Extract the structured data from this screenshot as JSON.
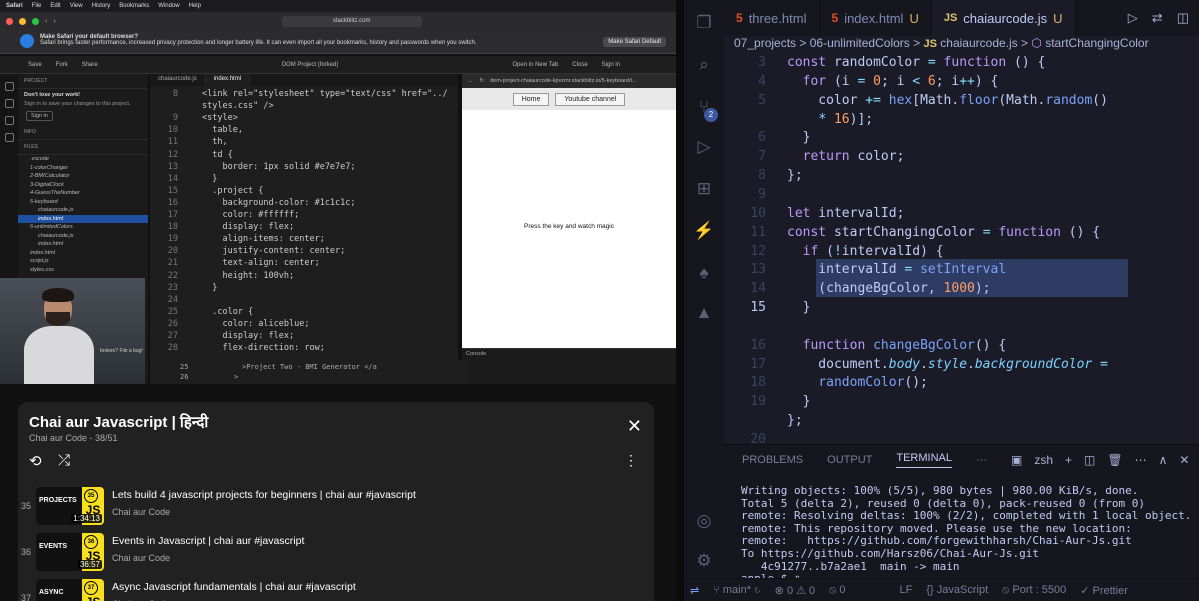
{
  "browser": {
    "menubar": [
      "Safari",
      "File",
      "Edit",
      "View",
      "History",
      "Bookmarks",
      "Window",
      "Help"
    ],
    "url": "stackblitz.com",
    "banner_title": "Make Safari your default browser?",
    "banner_text": "Safari brings faster performance, increased privacy protection and longer battery life. It can even import all your bookmarks, history and passwords when you switch.",
    "banner_button": "Make Safari Default"
  },
  "stackblitz": {
    "toolbar": {
      "save": "Save",
      "fork": "Fork",
      "share": "Share",
      "project": "DOM Project (forked)",
      "open_new_tab": "Open in New Tab",
      "close": "Close",
      "signin": "Sign in"
    },
    "sidebar": {
      "project_label": "PROJECT",
      "dont_lose": "Don't lose your work!",
      "signin_prompt": "Sign in to save your changes to this project.",
      "signin_btn": "Sign in",
      "info": "INFO",
      "files": "FILES",
      "items": [
        ".vscode",
        "1-colorChanger",
        "2-BMICalculator",
        "3-DigitalClock",
        "4-GuessTheNumber",
        "5-keyboard",
        "chaiaurcode.js",
        "index.html",
        "6-unlimitedColors",
        "chaiaurcode.js",
        "index.html",
        "index.html",
        "script.js",
        "styles.css"
      ],
      "selected_index": 7
    },
    "tabs": [
      "chaiaurcode.js",
      "index.html"
    ],
    "code_lines": [
      {
        "n": "8",
        "t": "<link rel=\"stylesheet\" type=\"text/css\" href=\"../"
      },
      {
        "n": "",
        "t": "styles.css\" />"
      },
      {
        "n": "9",
        "t": "<style>"
      },
      {
        "n": "10",
        "t": "  table,"
      },
      {
        "n": "11",
        "t": "  th,"
      },
      {
        "n": "12",
        "t": "  td {"
      },
      {
        "n": "13",
        "t": "    border: 1px solid #e7e7e7;"
      },
      {
        "n": "14",
        "t": "  }"
      },
      {
        "n": "15",
        "t": "  .project {"
      },
      {
        "n": "16",
        "t": "    background-color: #1c1c1c;"
      },
      {
        "n": "17",
        "t": "    color: #ffffff;"
      },
      {
        "n": "18",
        "t": "    display: flex;"
      },
      {
        "n": "19",
        "t": "    align-items: center;"
      },
      {
        "n": "20",
        "t": "    justify-content: center;"
      },
      {
        "n": "21",
        "t": "    text-align: center;"
      },
      {
        "n": "22",
        "t": "    height: 100vh;"
      },
      {
        "n": "23",
        "t": "  }"
      },
      {
        "n": "24",
        "t": ""
      },
      {
        "n": "25",
        "t": "  .color {"
      },
      {
        "n": "26",
        "t": "    color: aliceblue;"
      },
      {
        "n": "27",
        "t": "    display: flex;"
      },
      {
        "n": "28",
        "t": "    flex-direction: row;"
      }
    ],
    "under_lines": [
      {
        "n": "25",
        "t": ">Project Two - BMI Generator </a"
      },
      {
        "n": "26",
        "t": ">"
      }
    ],
    "preview": {
      "url": "dom-project-chaiaurcode-kpvzmr.stackblitz.io/5-keyboard/i...",
      "nav": [
        "Home",
        "Youtube channel"
      ],
      "body_text": "Press the key and watch magic",
      "console": "Console"
    },
    "webcam_caption": "broken? File a bug!"
  },
  "youtube": {
    "title": "Chai aur Javascript | हिन्दी",
    "subtitle": "Chai aur Code - 38/51",
    "items": [
      {
        "num": "35",
        "title": "Lets build 4 javascript projects for beginners | chai aur #javascript",
        "channel": "Chai aur Code",
        "duration": "1:34:13",
        "caption": "PROJECTS",
        "ep": "35"
      },
      {
        "num": "36",
        "title": "Events in Javascript | chai aur #javascript",
        "channel": "Chai aur Code",
        "duration": "36:57",
        "caption": "EVENTS",
        "ep": "36"
      },
      {
        "num": "37",
        "title": "Async Javascript fundamentals | chai aur #javascript",
        "channel": "Chai aur Code",
        "duration": "",
        "caption": "ASYNC",
        "ep": "37"
      }
    ]
  },
  "vscode": {
    "tabs": [
      {
        "label": "three.html",
        "type": "html",
        "mod": ""
      },
      {
        "label": "index.html",
        "type": "html",
        "mod": "U"
      },
      {
        "label": "chaiaurcode.js",
        "type": "js",
        "mod": "U"
      }
    ],
    "breadcrumb": {
      "p1": "07_projects",
      "p2": "06-unlimitedColors",
      "file": "chaiaurcode.js",
      "symbol": "startChangingColor"
    },
    "badge": "2",
    "panel_tabs": [
      "PROBLEMS",
      "OUTPUT",
      "TERMINAL",
      "···"
    ],
    "shell": "zsh",
    "terminal": [
      "Writing objects: 100% (5/5), 980 bytes | 980.00 KiB/s, done.",
      "Total 5 (delta 2), reused 0 (delta 0), pack-reused 0 (from 0)",
      "remote: Resolving deltas: 100% (2/2), completed with 1 local object.",
      "remote: This repository moved. Please use the new location:",
      "remote:   https://github.com/forgewithharsh/Chai-Aur-Js.git",
      "To https://github.com/Harsz06/Chai-Aur-Js.git",
      "   4c91277..b7a2ae1  main -> main",
      "apple~$ "
    ],
    "status": {
      "branch": "main*",
      "errors": "0",
      "warnings": "0",
      "eol": "LF",
      "lang": "JavaScript",
      "port": "Port : 5500",
      "prettier": "Prettier"
    },
    "line_numbers": [
      "3",
      "4",
      "5",
      "",
      "6",
      "7",
      "8",
      "9",
      "10",
      "11",
      "12",
      "13",
      "14",
      "15",
      "",
      "16",
      "17",
      "18",
      "19",
      "",
      "20",
      "21",
      "22"
    ]
  }
}
